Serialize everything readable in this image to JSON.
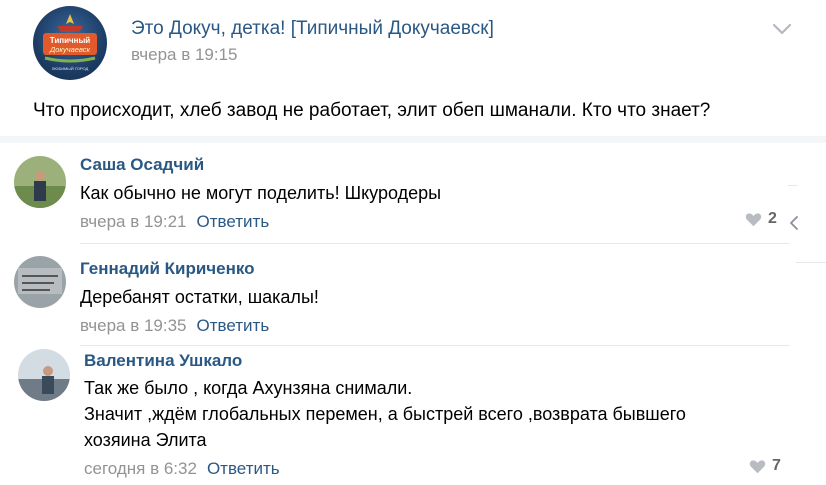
{
  "post": {
    "group_name": "Это Докуч, детка! [Типичный Докучаевск]",
    "time": "вчера в 19:15",
    "text": "Что происходит, хлеб завод не работает, элит обеп шманали. Кто что знает?",
    "avatar_line1": "Типичный",
    "avatar_line2": "Докучаевск",
    "avatar_caption": "ЛЮБИМЫЙ ГОРОД"
  },
  "comments": [
    {
      "author": "Саша Осадчий",
      "text_lines": [
        "Как обычно не могут поделить! Шкуродеры"
      ],
      "time": "вчера в 19:21",
      "reply_label": "Ответить",
      "likes": "2"
    },
    {
      "author": "Геннадий Кириченко",
      "text_lines": [
        "Деребанят остатки, шакалы!"
      ],
      "time": "вчера в 19:35",
      "reply_label": "Ответить",
      "likes": ""
    },
    {
      "author": "Валентина Ушкало",
      "text_lines": [
        "Так же было , когда Ахунзяна снимали.",
        "Значит ,ждём глобальных перемен, а быстрей всего ,возврата бывшего",
        "хозяина Элита"
      ],
      "time": "сегодня в 6:32",
      "reply_label": "Ответить",
      "likes": "7"
    }
  ],
  "colors": {
    "link": "#2a5885",
    "muted": "#939393",
    "accent_brand": "#e05a2b"
  },
  "icons": {
    "post_menu": "chevron-down-icon",
    "like": "heart-icon",
    "side_nav": "chevron-left-icon"
  }
}
